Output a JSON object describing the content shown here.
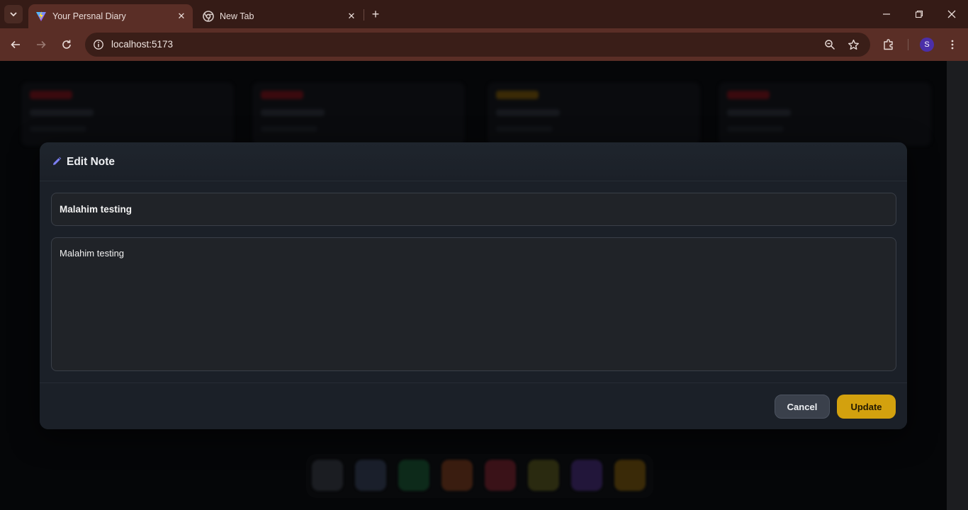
{
  "browser": {
    "tabs": [
      {
        "title": "Your Persnal Diary",
        "active": true,
        "icon": "vite-logo-icon"
      },
      {
        "title": "New Tab",
        "active": false,
        "icon": "chrome-icon"
      }
    ],
    "address": {
      "url": "localhost:5173"
    },
    "profile_initial": "S"
  },
  "modal": {
    "heading": "Edit Note",
    "title_value": "Malahim testing",
    "body_value": "Malahim testing",
    "buttons": {
      "cancel": "Cancel",
      "update": "Update"
    },
    "colors": {
      "update": "#d3a10e",
      "cancel": "#3a404b",
      "pencil": "#7c7ff2"
    }
  },
  "background": {
    "card_chip_colors": [
      "#3a0a0e",
      "#3a0a0e",
      "#3a2a06",
      "#3a0a0e"
    ],
    "dock_colors": [
      "#1b1d22",
      "#1a1f2b",
      "#0d2a1a",
      "#3a1d10",
      "#3a1218",
      "#2a2a10",
      "#22163a",
      "#3a2a08"
    ]
  }
}
